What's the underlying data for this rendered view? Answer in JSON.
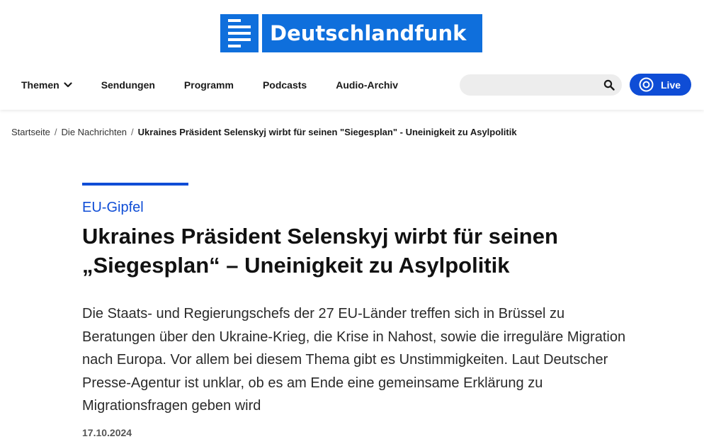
{
  "brand": {
    "name": "Deutschlandfunk",
    "color": "#0f6fdc"
  },
  "nav": {
    "items": [
      {
        "label": "Themen",
        "has_dropdown": true
      },
      {
        "label": "Sendungen"
      },
      {
        "label": "Programm"
      },
      {
        "label": "Podcasts"
      },
      {
        "label": "Audio-Archiv"
      }
    ]
  },
  "search": {
    "placeholder": "",
    "icon": "search-icon"
  },
  "live": {
    "label": "Live",
    "color": "#0f4dd6",
    "icon": "live-radio-icon"
  },
  "breadcrumb": {
    "items": [
      {
        "label": "Startseite"
      },
      {
        "label": "Die Nachrichten"
      }
    ],
    "separator": "/",
    "current": "Ukraines Präsident Selenskyj wirbt für seinen \"Siegesplan\" - Uneinigkeit zu Asylpolitik"
  },
  "article": {
    "kicker": "EU-Gipfel",
    "headline": "Ukraines Präsident Selenskyj wirbt für seinen „Siegesplan“ – Uneinigkeit zu Asylpolitik",
    "teaser": "Die Staats- und Regierungschefs der 27 EU-Länder treffen sich in Brüssel zu Beratungen über den Ukraine-Krieg, die Krise in Nahost, sowie die irreguläre Migration nach Europa. Vor allem bei diesem Thema gibt es Unstimmigkeiten. Laut Deutscher Presse-Agentur ist unklar, ob es am Ende eine gemeinsame Erklärung zu Migrationsfragen geben wird",
    "date": "17.10.2024",
    "accent_color": "#0f4dd6"
  }
}
